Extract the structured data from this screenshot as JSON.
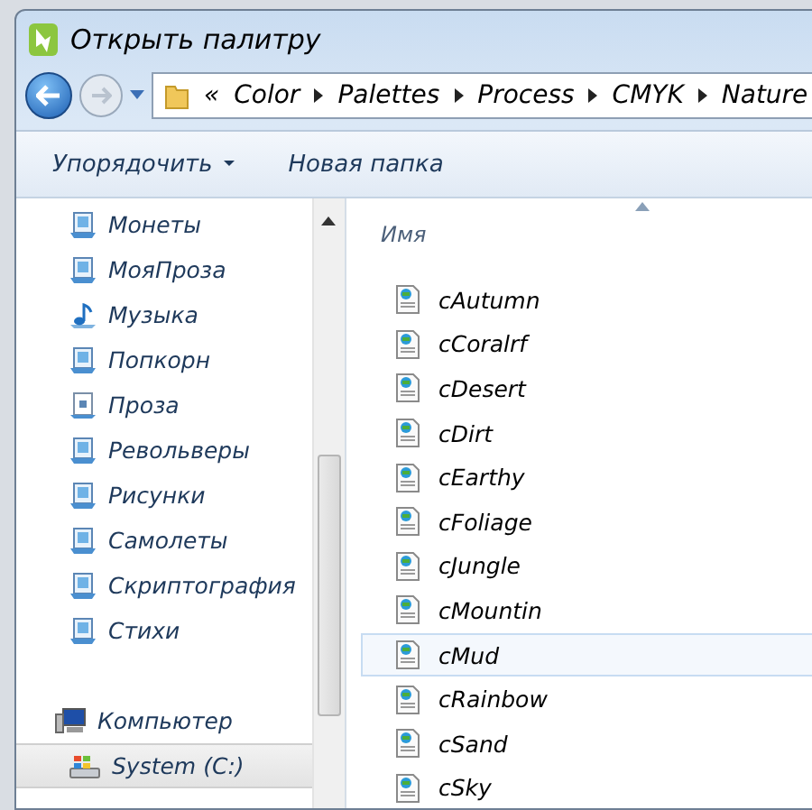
{
  "window": {
    "title": "Открыть палитру"
  },
  "nav": {
    "overflow": "«",
    "path": [
      "Color",
      "Palettes",
      "Process",
      "CMYK",
      "Nature"
    ]
  },
  "toolbar": [
    {
      "label": "Упорядочить",
      "dropdown": true
    },
    {
      "label": "Новая папка",
      "dropdown": false
    }
  ],
  "sidebar": {
    "items": [
      {
        "label": "Монеты",
        "kind": "library",
        "selected": false
      },
      {
        "label": "МояПроза",
        "kind": "library",
        "selected": false
      },
      {
        "label": "Музыка",
        "kind": "music",
        "selected": false
      },
      {
        "label": "Попкорн",
        "kind": "library",
        "selected": false
      },
      {
        "label": "Проза",
        "kind": "document",
        "selected": false
      },
      {
        "label": "Револьверы",
        "kind": "library",
        "selected": false
      },
      {
        "label": "Рисунки",
        "kind": "library",
        "selected": false
      },
      {
        "label": "Самолеты",
        "kind": "library",
        "selected": false
      },
      {
        "label": "Скриптография",
        "kind": "library",
        "selected": false
      },
      {
        "label": "Стихи",
        "kind": "library",
        "selected": false
      },
      {
        "label": "Компьютер",
        "kind": "computer",
        "selected": false
      },
      {
        "label": "System (C:)",
        "kind": "drive",
        "selected": true
      }
    ]
  },
  "file_list": {
    "column": "Имя",
    "files": [
      {
        "name": "cAutumn",
        "selected": false
      },
      {
        "name": "cCoralrf",
        "selected": false
      },
      {
        "name": "cDesert",
        "selected": false
      },
      {
        "name": "cDirt",
        "selected": false
      },
      {
        "name": "cEarthy",
        "selected": false
      },
      {
        "name": "cFoliage",
        "selected": false
      },
      {
        "name": "cJungle",
        "selected": false
      },
      {
        "name": "cMountin",
        "selected": false
      },
      {
        "name": "cMud",
        "selected": true
      },
      {
        "name": "cRainbow",
        "selected": false
      },
      {
        "name": "cSand",
        "selected": false
      },
      {
        "name": "cSky",
        "selected": false
      }
    ]
  }
}
